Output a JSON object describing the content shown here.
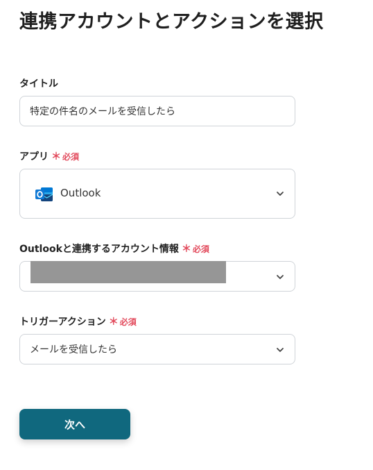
{
  "page": {
    "title": "連携アカウントとアクションを選択"
  },
  "required_label": "必須",
  "required_star": "＊",
  "fields": {
    "title": {
      "label": "タイトル",
      "value": "特定の件名のメールを受信したら"
    },
    "app": {
      "label": "アプリ",
      "value": "Outlook",
      "icon": "outlook-icon"
    },
    "account": {
      "label": "Outlookと連携するアカウント情報",
      "value_redacted": true
    },
    "trigger_action": {
      "label": "トリガーアクション",
      "value": "メールを受信したら"
    }
  },
  "buttons": {
    "next_label": "次へ"
  },
  "colors": {
    "primary_button": "#10687e",
    "required": "#e24a5c",
    "outlook_blue": "#0f78d4"
  }
}
